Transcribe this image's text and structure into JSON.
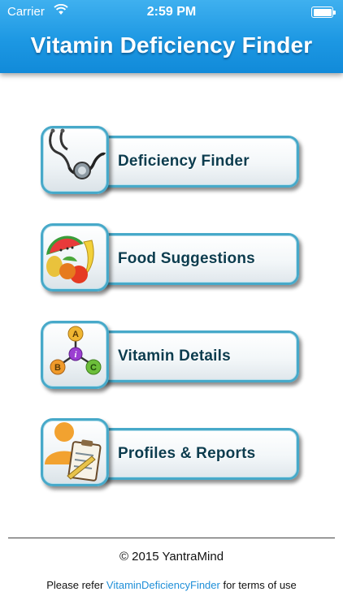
{
  "status_bar": {
    "carrier": "Carrier",
    "time": "2:59 PM",
    "wifi_icon": "wifi-icon",
    "battery_icon": "battery-icon"
  },
  "header": {
    "title": "Vitamin Deficiency Finder"
  },
  "menu": [
    {
      "label": "Deficiency Finder",
      "icon": "stethoscope-icon"
    },
    {
      "label": "Food Suggestions",
      "icon": "fruits-icon"
    },
    {
      "label": "Vitamin Details",
      "icon": "vitamin-molecule-icon"
    },
    {
      "label": "Profiles & Reports",
      "icon": "profile-report-icon"
    }
  ],
  "footer": {
    "copyright": "© 2015 YantraMind",
    "terms_prefix": "Please refer ",
    "terms_link": "VitaminDeficiencyFinder",
    "terms_suffix": " for terms of use"
  },
  "colors": {
    "header_blue": "#1d98e3",
    "button_border": "#47a9c9",
    "button_text": "#0c3c4e",
    "link": "#1f8fd8"
  }
}
